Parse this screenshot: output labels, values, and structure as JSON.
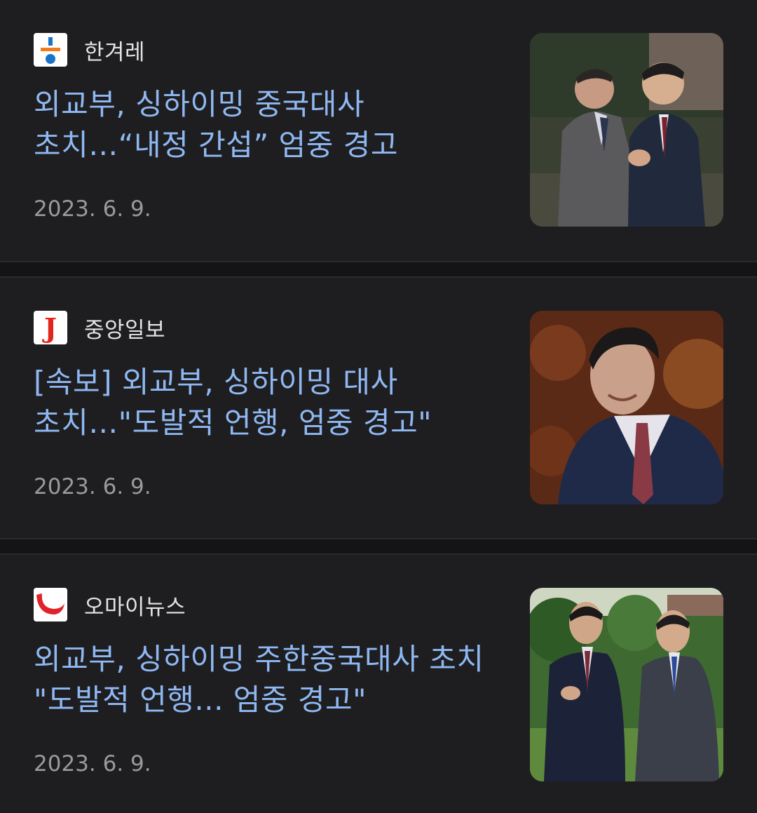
{
  "articles": [
    {
      "source": "한겨레",
      "source_logo": "hankyoreh-logo-icon",
      "headline": "외교부, 싱하이밍 중국대사 초치…“내정 간섭” 엄중 경고",
      "date": "2023. 6. 9.",
      "thumbnail": "two-men-handshake-photo"
    },
    {
      "source": "중앙일보",
      "source_logo": "joongang-logo-icon",
      "headline": "[속보] 외교부, 싱하이밍 대사 초치…\"도발적 언행, 엄중 경고\"",
      "date": "2023. 6. 9.",
      "thumbnail": "ambassador-portrait-photo"
    },
    {
      "source": "오마이뉴스",
      "source_logo": "ohmynews-logo-icon",
      "headline": "외교부, 싱하이밍 주한중국대사 초치 \"도발적 언행... 엄중 경고\"",
      "date": "2023. 6. 9.",
      "thumbnail": "two-men-garden-photo"
    }
  ],
  "colors": {
    "background": "#1e1e20",
    "separator": "#141416",
    "headline": "#8fb8f2",
    "source_text": "#e4e4e4",
    "date_text": "#9a9a9a"
  }
}
